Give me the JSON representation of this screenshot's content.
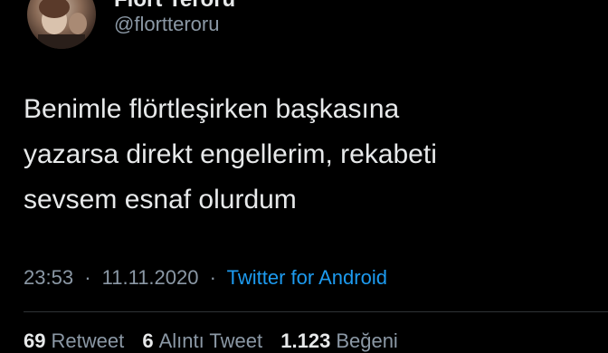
{
  "user": {
    "display_name": "Flört Terörü",
    "handle": "@flortteroru"
  },
  "tweet": {
    "lines": [
      "Benimle flörtleşirken başkasına",
      "yazarsa direkt engellerim, rekabeti",
      "sevsem esnaf olurdum"
    ],
    "time": "23:53",
    "separator": "·",
    "date": "11.11.2020",
    "source": "Twitter for Android"
  },
  "stats": {
    "retweets_count": "69",
    "retweets_label": "Retweet",
    "quotes_count": "6",
    "quotes_label": "Alıntı Tweet",
    "likes_count": "1.123",
    "likes_label": "Beğeni"
  },
  "colors": {
    "background": "#000000",
    "text": "#e7e9ea",
    "secondary": "#8b98a5",
    "link": "#1d9bf0"
  }
}
